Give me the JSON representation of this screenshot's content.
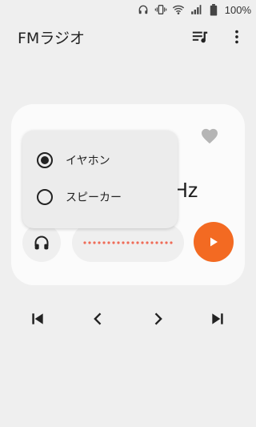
{
  "status_bar": {
    "icons": [
      "headphones-icon",
      "vibrate-icon",
      "wifi-icon",
      "signal-icon",
      "battery-icon"
    ],
    "battery_text": "100%"
  },
  "app_bar": {
    "title": "FMラジオ",
    "actions": [
      "playlist-icon",
      "more-vert-icon"
    ]
  },
  "player": {
    "frequency_suffix": "Hz",
    "favorite_icon": "heart-icon",
    "output_icon": "headphones-icon",
    "play_icon": "play-icon",
    "accent_color": "#f36a22"
  },
  "output_menu": {
    "options": [
      {
        "label": "イヤホン",
        "selected": true
      },
      {
        "label": "スピーカー",
        "selected": false
      }
    ]
  },
  "controls": [
    "skip-previous-icon",
    "chevron-left-icon",
    "chevron-right-icon",
    "skip-next-icon"
  ]
}
